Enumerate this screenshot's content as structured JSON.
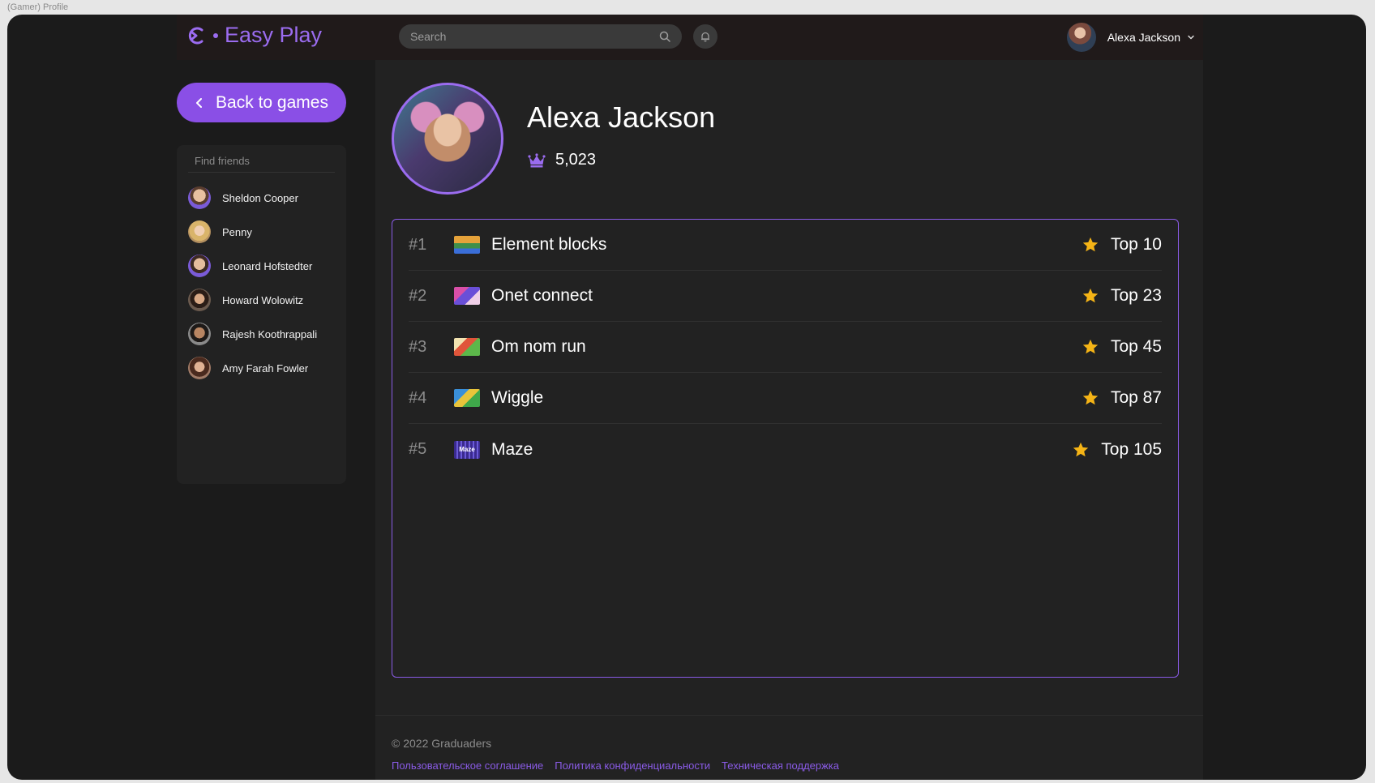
{
  "frame_label": "(Gamer) Profile",
  "header": {
    "app_name": "Easy Play",
    "search_placeholder": "Search",
    "user_name": "Alexa Jackson"
  },
  "sidebar": {
    "back_label": "Back to games",
    "friend_search_placeholder": "Find friends",
    "friends": [
      {
        "name": "Sheldon Cooper"
      },
      {
        "name": "Penny"
      },
      {
        "name": "Leonard Hofstedter"
      },
      {
        "name": "Howard Wolowitz"
      },
      {
        "name": "Rajesh Koothrappali"
      },
      {
        "name": "Amy Farah Fowler"
      }
    ]
  },
  "profile": {
    "name": "Alexa Jackson",
    "score": "5,023"
  },
  "games": [
    {
      "rank": "#1",
      "name": "Element blocks",
      "place": "Top 10"
    },
    {
      "rank": "#2",
      "name": "Onet connect",
      "place": "Top 23"
    },
    {
      "rank": "#3",
      "name": "Om nom run",
      "place": "Top 45"
    },
    {
      "rank": "#4",
      "name": "Wiggle",
      "place": "Top 87"
    },
    {
      "rank": "#5",
      "name": "Maze",
      "place": "Top 105",
      "thumb_text": "Maze"
    }
  ],
  "footer": {
    "copyright": "© 2022  Graduaders",
    "links": [
      "Пользовательское соглашение",
      "Политика конфиденциальности",
      "Техническая поддержка"
    ]
  },
  "colors": {
    "accent": "#8a4fe6",
    "star": "#f5b416",
    "background": "#1b1b1b",
    "panel": "#222222"
  }
}
